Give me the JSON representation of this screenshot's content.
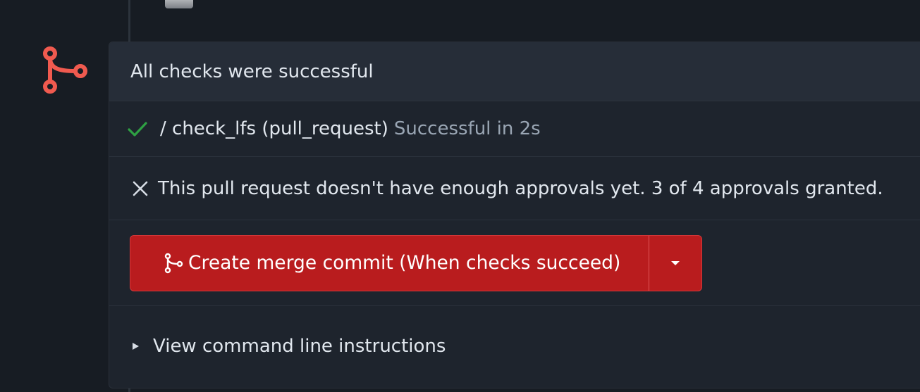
{
  "colors": {
    "background": "#171c23",
    "panel": "#1e242d",
    "header": "#262d38",
    "accent_red": "#b91c1e",
    "merge_badge": "#f05a4f",
    "success_green": "#2ea043",
    "muted_text": "#9aa6b4"
  },
  "icons": {
    "badge": "git-merge-icon",
    "check": "check-icon",
    "fail": "x-icon",
    "button": "git-merge-icon",
    "dropdown": "caret-down-icon",
    "disclosure": "triangle-right-icon"
  },
  "merge_box": {
    "header_title": "All checks were successful",
    "check": {
      "name": "/ check_lfs (pull_request)",
      "status": "Successful in 2s"
    },
    "approvals": {
      "text": "This pull request doesn't have enough approvals yet. 3 of 4 approvals granted."
    },
    "merge_button": {
      "label": "Create merge commit (When checks succeed)"
    },
    "instructions": {
      "label": "View command line instructions"
    }
  }
}
